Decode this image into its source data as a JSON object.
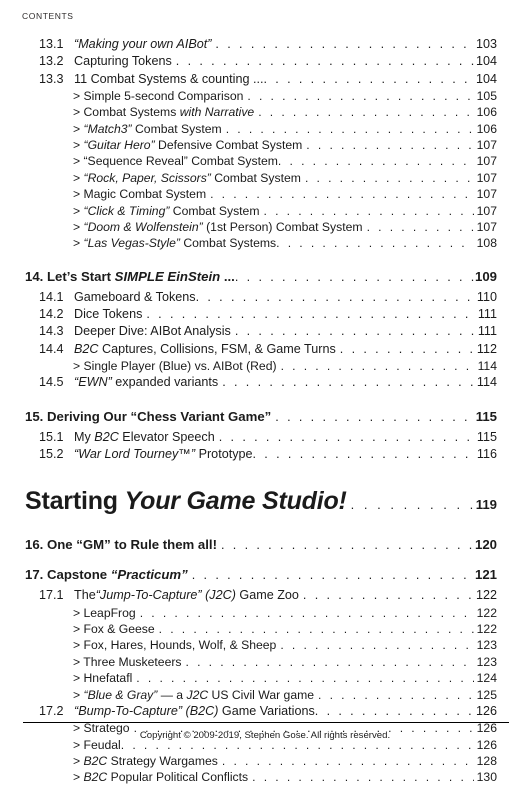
{
  "document": {
    "running_head": "CONTENTS",
    "footer": "Copyright © 2009-2019, Stephen Gose.  All rights reserved."
  },
  "entries": {
    "s13_1": {
      "number": "13.1",
      "title_pre": "",
      "title_em": "“Making your own AIBot”",
      "title_post": "",
      "page": "103"
    },
    "s13_2": {
      "number": "13.2",
      "title_pre": "Capturing Tokens",
      "title_em": "",
      "title_post": "",
      "page": "104"
    },
    "s13_3": {
      "number": "13.3",
      "title_pre": "11 Combat Systems & counting ...",
      "title_em": "",
      "title_post": "",
      "page": "104"
    },
    "i13_3_1": {
      "pre": "> Simple 5-second Comparison",
      "em": "",
      "post": "",
      "page": "105"
    },
    "i13_3_2": {
      "pre": "> Combat Systems ",
      "em": "with Narrative",
      "post": "",
      "page": "106"
    },
    "i13_3_3": {
      "pre": "> ",
      "em": "“Match3”",
      "post": " Combat System",
      "page": "106"
    },
    "i13_3_4": {
      "pre": "> ",
      "em": "“Guitar Hero”",
      "post": " Defensive Combat System",
      "page": "107"
    },
    "i13_3_5": {
      "pre": "> “Sequence Reveal” Combat System",
      "em": "",
      "post": "",
      "page": "107"
    },
    "i13_3_6": {
      "pre": "> ",
      "em": "“Rock, Paper, Scissors”",
      "post": " Combat System",
      "page": "107"
    },
    "i13_3_7": {
      "pre": "> Magic Combat System",
      "em": "",
      "post": "",
      "page": "107"
    },
    "i13_3_8": {
      "pre": "> ",
      "em": "“Click & Timing”",
      "post": " Combat System",
      "page": "107"
    },
    "i13_3_9": {
      "pre": "> ",
      "em": "“Doom & Wolfenstein”",
      "post": " (1st Person) Combat System",
      "page": "107"
    },
    "i13_3_10": {
      "pre": "> ",
      "em": "“Las Vegas-Style”",
      "post": " Combat Systems",
      "page": "108"
    },
    "c14": {
      "pre": "14. Let’s Start ",
      "em": "SIMPLE EinStein",
      "post": " ...",
      "page": "109"
    },
    "s14_1": {
      "number": "14.1",
      "title_pre": "Gameboard & Tokens",
      "title_em": "",
      "title_post": "",
      "page": "110"
    },
    "s14_2": {
      "number": "14.2",
      "title_pre": "Dice Tokens",
      "title_em": "",
      "title_post": "",
      "page": "111"
    },
    "s14_3": {
      "number": "14.3",
      "title_pre": "Deeper Dive: AIBot Analysis",
      "title_em": "",
      "title_post": "",
      "page": "111"
    },
    "s14_4": {
      "number": "14.4",
      "title_pre": "",
      "title_em": "B2C",
      "title_post": " Captures, Collisions, FSM, & Game Turns",
      "page": "112"
    },
    "i14_4_1": {
      "pre": "> Single Player (Blue) vs. AIBot (Red)",
      "em": "",
      "post": "",
      "page": "114"
    },
    "s14_5": {
      "number": "14.5",
      "title_pre": "",
      "title_em": "“EWN”",
      "title_post": " expanded variants",
      "page": "114"
    },
    "c15": {
      "pre": "15. Deriving Our “Chess Variant Game”",
      "em": "",
      "post": "",
      "page": "115"
    },
    "s15_1": {
      "number": "15.1",
      "title_pre": "My ",
      "title_em": "B2C",
      "title_post": " Elevator Speech",
      "page": "115"
    },
    "s15_2": {
      "number": "15.2",
      "title_pre": "",
      "title_em": "“War Lord Tourney™”",
      "title_post": " Prototype",
      "page": "116"
    },
    "part": {
      "pre": "Starting ",
      "em": "Your Game Studio!",
      "post": "",
      "page": "119"
    },
    "c16": {
      "pre": "16. One “GM” to Rule them all!",
      "em": "",
      "post": "",
      "page": "120"
    },
    "c17": {
      "pre": "17. Capstone ",
      "em": "“Practicum”",
      "post": "",
      "page": "121"
    },
    "s17_1": {
      "number": "17.1",
      "title_pre": "The",
      "title_em": "“Jump-To-Capture” (J2C)",
      "title_post": " Game Zoo",
      "page": "122"
    },
    "i17_1_1": {
      "pre": "> LeapFrog",
      "em": "",
      "post": "",
      "page": "122"
    },
    "i17_1_2": {
      "pre": "> Fox & Geese",
      "em": "",
      "post": "",
      "page": "122"
    },
    "i17_1_3": {
      "pre": "> Fox, Hares, Hounds, Wolf, & Sheep",
      "em": "",
      "post": "",
      "page": "123"
    },
    "i17_1_4": {
      "pre": "> Three Musketeers",
      "em": "",
      "post": "",
      "page": "123"
    },
    "i17_1_5": {
      "pre": "> Hnefatafl",
      "em": "",
      "post": "",
      "page": "124"
    },
    "i17_1_6": {
      "pre": "> ",
      "em": "“Blue & Gray”",
      "post": " — a ",
      "em2": "J2C",
      "post2": " US Civil War game",
      "page": "125"
    },
    "s17_2": {
      "number": "17.2",
      "title_pre": "",
      "title_em": "“Bump-To-Capture” (B2C)",
      "title_post": " Game Variations",
      "page": "126"
    },
    "i17_2_1": {
      "pre": "> Stratego",
      "em": "",
      "post": "",
      "page": "126"
    },
    "i17_2_2": {
      "pre": "> Feudal",
      "em": "",
      "post": "",
      "page": "126"
    },
    "i17_2_3": {
      "pre": "> ",
      "em": "B2C",
      "post": " Strategy Wargames",
      "page": "128"
    },
    "i17_2_4": {
      "pre": "> ",
      "em": "B2C",
      "post": " Popular Political Conflicts",
      "page": "130"
    }
  }
}
